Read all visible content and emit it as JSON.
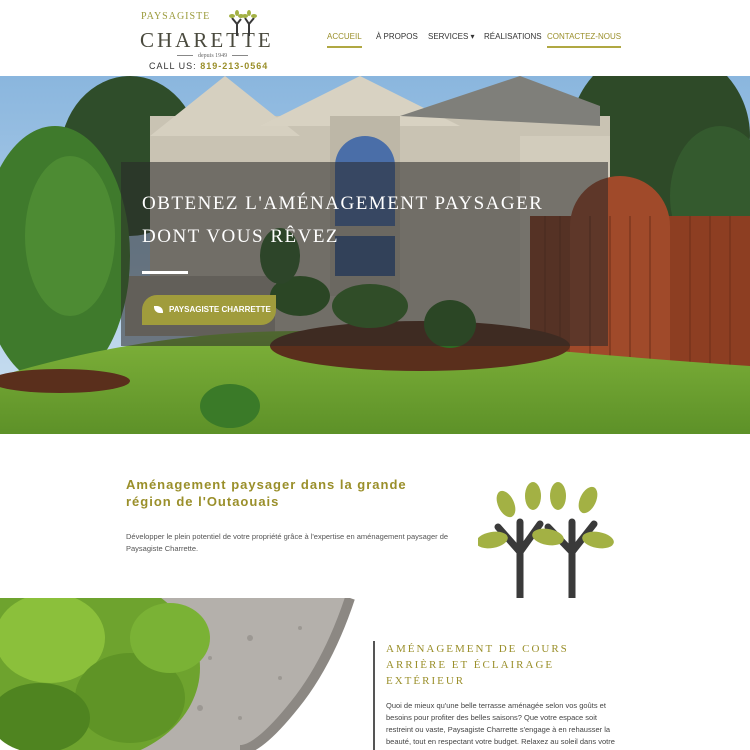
{
  "header": {
    "logo_top": "PAYSAGISTE",
    "logo_main": "CHARETTE",
    "logo_sub": "depuis 1949",
    "call_label": "CALL US:",
    "phone": "819-213-0564"
  },
  "nav": {
    "items": [
      {
        "label": "ACCUEIL"
      },
      {
        "label": "À PROPOS"
      },
      {
        "label": "SERVICES ▾"
      },
      {
        "label": "RÉALISATIONS"
      },
      {
        "label": "CONTACTEZ-NOUS"
      }
    ]
  },
  "hero": {
    "title_line1": "OBTENEZ L'AMÉNAGEMENT PAYSAGER",
    "title_line2": "DONT VOUS RÊVEZ",
    "button_label": "PAYSAGISTE CHARRETTE"
  },
  "intro": {
    "title": "Aménagement paysager dans la grande région de l'Outaouais",
    "text": "Développer le plein potentiel de votre propriété grâce à l'expertise en aménagement paysager de Paysagiste Charrette."
  },
  "lower": {
    "title": "AMÉNAGEMENT DE COURS ARRIÈRE ET ÉCLAIRAGE EXTÉRIEUR",
    "text": "Quoi de mieux qu'une belle terrasse aménagée selon vos goûts et besoins pour profiter des belles saisons? Que votre espace soit restreint ou vaste, Paysagiste Charrette s'engage à en rehausser la beauté, tout en respectant votre budget. Relaxez au soleil dans votre"
  },
  "colors": {
    "accent": "#9a8f2a",
    "button": "#a09c3c",
    "tree_leaf": "#a3b144",
    "tree_trunk": "#3a3a3a"
  }
}
